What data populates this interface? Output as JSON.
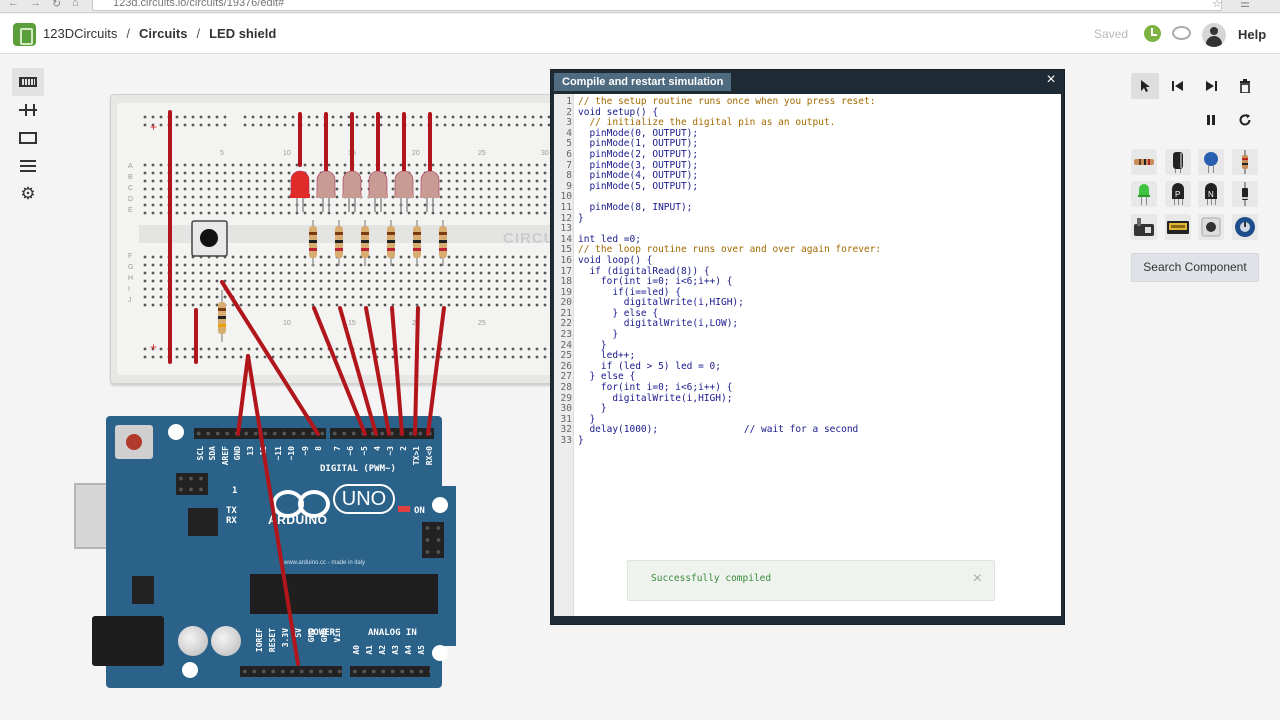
{
  "browser": {
    "url": "123d.circuits.io/circuits/19376/edit#"
  },
  "header": {
    "brand_bold": "123D",
    "brand_rest": " Circuits",
    "crumb_1": "Circuits",
    "crumb_2": "LED shield",
    "saved_label": "Saved",
    "help_label": "Help"
  },
  "left_tools": [
    "breadboard-icon",
    "battery-icon",
    "chip-icon",
    "list-icon",
    "gear-icon"
  ],
  "breadboard": {
    "row_labels_top": [
      "A",
      "B",
      "C",
      "D",
      "E"
    ],
    "row_labels_bottom": [
      "F",
      "G",
      "H",
      "I",
      "J"
    ],
    "col_labels": [
      "5",
      "10",
      "15",
      "20",
      "25",
      "30"
    ],
    "watermark": "CIRCU"
  },
  "arduino": {
    "top_labels": [
      "SCL",
      "SDA",
      "AREF",
      "GND",
      "13",
      "12",
      "~11",
      "~10",
      "~9",
      "8",
      "7",
      "~6",
      "~5",
      "4",
      "~3",
      "2",
      "TX>1",
      "RX<0"
    ],
    "digital_label": "DIGITAL (PWM~)",
    "power_label": "POWER",
    "analog_label": "ANALOG IN",
    "power_pins": [
      "IOREF",
      "RESET",
      "3.3V",
      "5V",
      "GND",
      "GND",
      "Vin"
    ],
    "analog_pins": [
      "A0",
      "A1",
      "A2",
      "A3",
      "A4",
      "A5"
    ],
    "name": "ARDUINO",
    "model": "UNO",
    "tx": "TX",
    "rx": "RX",
    "l": "L",
    "on": "ON",
    "url": "www.arduino.cc - made in italy"
  },
  "editor": {
    "tab_label": "Compile and restart simulation",
    "close_glyph": "×",
    "lines": [
      {
        "n": "1",
        "t": "// the setup routine runs once when you press reset:",
        "cls": "cm"
      },
      {
        "n": "2",
        "t": "void setup() {",
        "cls": "kw"
      },
      {
        "n": "3",
        "t": "  // initialize the digital pin as an output.",
        "cls": "cm"
      },
      {
        "n": "4",
        "t": "  pinMode(0, OUTPUT);",
        "cls": "kw"
      },
      {
        "n": "5",
        "t": "  pinMode(1, OUTPUT);",
        "cls": "kw"
      },
      {
        "n": "6",
        "t": "  pinMode(2, OUTPUT);",
        "cls": "kw"
      },
      {
        "n": "7",
        "t": "  pinMode(3, OUTPUT);",
        "cls": "kw"
      },
      {
        "n": "8",
        "t": "  pinMode(4, OUTPUT);",
        "cls": "kw"
      },
      {
        "n": "9",
        "t": "  pinMode(5, OUTPUT);",
        "cls": "kw"
      },
      {
        "n": "10",
        "t": "",
        "cls": "kw"
      },
      {
        "n": "11",
        "t": "  pinMode(8, INPUT);",
        "cls": "kw"
      },
      {
        "n": "12",
        "t": "}",
        "cls": "kw"
      },
      {
        "n": "13",
        "t": "",
        "cls": "kw"
      },
      {
        "n": "14",
        "t": "int led =0;",
        "cls": "kw"
      },
      {
        "n": "15",
        "t": "// the loop routine runs over and over again forever:",
        "cls": "cm"
      },
      {
        "n": "16",
        "t": "void loop() {",
        "cls": "kw"
      },
      {
        "n": "17",
        "t": "  if (digitalRead(8)) {",
        "cls": "kw"
      },
      {
        "n": "18",
        "t": "    for(int i=0; i<6;i++) {",
        "cls": "kw"
      },
      {
        "n": "19",
        "t": "      if(i==led) {",
        "cls": "kw"
      },
      {
        "n": "20",
        "t": "        digitalWrite(i,HIGH);",
        "cls": "kw"
      },
      {
        "n": "21",
        "t": "      } else {",
        "cls": "kw"
      },
      {
        "n": "22",
        "t": "        digitalWrite(i,LOW);",
        "cls": "kw"
      },
      {
        "n": "23",
        "t": "      }",
        "cls": "kw"
      },
      {
        "n": "24",
        "t": "    }",
        "cls": "kw"
      },
      {
        "n": "25",
        "t": "    led++;",
        "cls": "kw"
      },
      {
        "n": "26",
        "t": "    if (led > 5) led = 0;",
        "cls": "kw"
      },
      {
        "n": "27",
        "t": "  } else {",
        "cls": "kw"
      },
      {
        "n": "28",
        "t": "    for(int i=0; i<6;i++) {",
        "cls": "kw"
      },
      {
        "n": "29",
        "t": "      digitalWrite(i,HIGH);",
        "cls": "kw"
      },
      {
        "n": "30",
        "t": "    }",
        "cls": "kw"
      },
      {
        "n": "31",
        "t": "  }",
        "cls": "kw"
      },
      {
        "n": "32",
        "t": "  delay(1000);               // wait for a second",
        "cls": "kw"
      },
      {
        "n": "33",
        "t": "}",
        "cls": "kw"
      }
    ],
    "toast_message": "Successfully compiled",
    "toast_close": "×"
  },
  "right_toolbar": {
    "tools": [
      "pointer-icon",
      "step-back-icon",
      "step-forward-icon",
      "trash-icon",
      "pause-icon",
      "restart-icon"
    ],
    "components": [
      "resistor-part-icon",
      "electrolytic-capacitor-part-icon",
      "ceramic-capacitor-part-icon",
      "resistor-vertical-part-icon",
      "green-led-part-icon",
      "pnp-transistor-part-icon",
      "npn-transistor-part-icon",
      "diode-part-icon",
      "motor-part-icon",
      "lcd-part-icon",
      "pushbutton-part-icon",
      "potentiometer-part-icon"
    ],
    "search_label": "Search Component",
    "pnp_letter": "P",
    "npn_letter": "N"
  },
  "colors": {
    "wire": "#b0161b",
    "board": "#2a6289",
    "led_on": "#e02b2b",
    "led_off": "#c89b95"
  }
}
